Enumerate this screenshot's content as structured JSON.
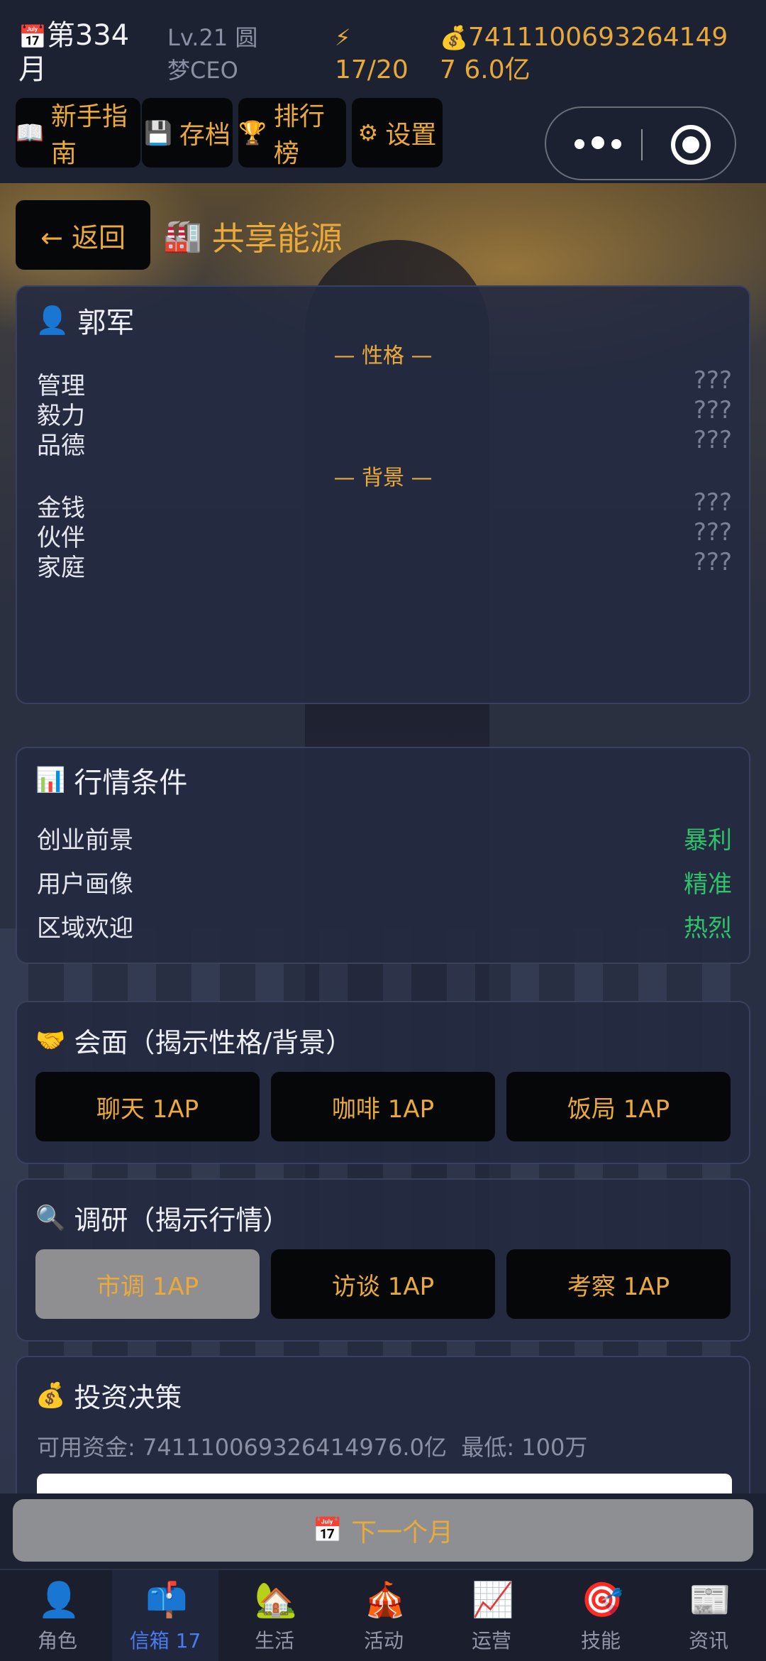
{
  "status": {
    "month": "第334月",
    "level": "Lv.21 圆梦CEO",
    "ap": "17/20",
    "money": "74111006932641497 6.0亿"
  },
  "menu": [
    {
      "label": "新手指南",
      "icon": "book-icon"
    },
    {
      "label": "存档",
      "icon": "floppy-icon"
    },
    {
      "label": "排行榜",
      "icon": "trophy-icon"
    },
    {
      "label": "设置",
      "icon": "gear-icon"
    }
  ],
  "header": {
    "back_label": "← 返回",
    "title": "共享能源"
  },
  "person": {
    "name": "郭军",
    "personality_label": "— 性格 —",
    "personality": [
      {
        "k": "管理",
        "v": "???"
      },
      {
        "k": "毅力",
        "v": "???"
      },
      {
        "k": "品德",
        "v": "???"
      }
    ],
    "background_label": "— 背景 —",
    "background": [
      {
        "k": "金钱",
        "v": "???"
      },
      {
        "k": "伙伴",
        "v": "???"
      },
      {
        "k": "家庭",
        "v": "???"
      }
    ]
  },
  "market": {
    "title": "行情条件",
    "rows": [
      {
        "k": "创业前景",
        "v": "暴利"
      },
      {
        "k": "用户画像",
        "v": "精准"
      },
      {
        "k": "区域欢迎",
        "v": "热烈"
      }
    ]
  },
  "meet": {
    "title": "会面（揭示性格/背景）",
    "buttons": [
      "聊天 1AP",
      "咖啡 1AP",
      "饭局 1AP"
    ]
  },
  "research": {
    "title": "调研（揭示行情）",
    "buttons": [
      "市调 1AP",
      "访谈 1AP",
      "考察 1AP"
    ]
  },
  "invest": {
    "title": "投资决策",
    "funds": "可用资金: 741110069326414976.0亿",
    "min": "最低: 100万"
  },
  "next_month": "下一个月",
  "tabs": [
    {
      "label": "角色",
      "icon": "person-icon"
    },
    {
      "label": "信箱 17",
      "icon": "mailbox-icon"
    },
    {
      "label": "生活",
      "icon": "house-icon"
    },
    {
      "label": "活动",
      "icon": "tent-icon"
    },
    {
      "label": "运营",
      "icon": "chart-icon"
    },
    {
      "label": "技能",
      "icon": "target-icon"
    },
    {
      "label": "资讯",
      "icon": "newspaper-icon"
    }
  ],
  "colors": {
    "accent": "#e9a93b",
    "good": "#2fc26a",
    "active_tab": "#4a7cf0"
  }
}
